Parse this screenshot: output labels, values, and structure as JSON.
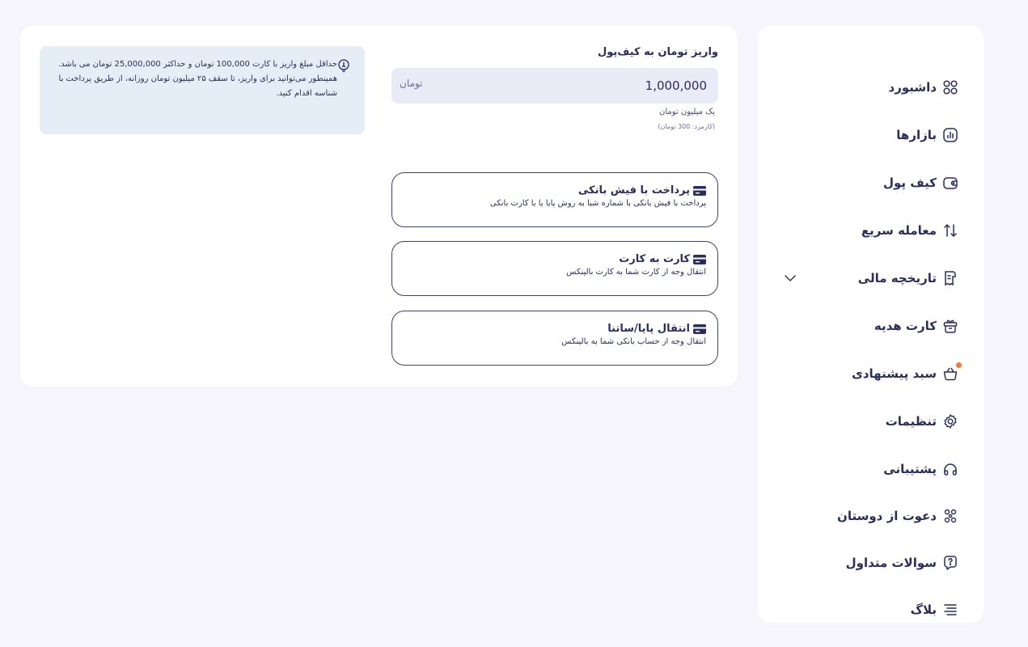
{
  "sidebar": {
    "items": [
      {
        "label": "داشبورد",
        "icon": "dashboard-grid-icon"
      },
      {
        "label": "بازارها",
        "icon": "markets-chart-icon"
      },
      {
        "label": "کیف پول",
        "icon": "wallet-icon"
      },
      {
        "label": "معامله سریع",
        "icon": "swap-arrows-icon"
      },
      {
        "label": "تاریخچه مالی",
        "icon": "receipt-icon",
        "expandable": true
      },
      {
        "label": "کارت هدیه",
        "icon": "gift-icon"
      },
      {
        "label": "سبد پیشنهادی",
        "icon": "basket-icon",
        "badge_dot": true
      },
      {
        "label": "تنظیمات",
        "icon": "gear-icon"
      },
      {
        "label": "پشتیبانی",
        "icon": "headphones-icon"
      },
      {
        "label": "دعوت از دوستان",
        "icon": "invite-friends-icon"
      },
      {
        "label": "سوالات متداول",
        "icon": "faq-chat-icon"
      },
      {
        "label": "بلاگ",
        "icon": "blog-lines-icon"
      }
    ]
  },
  "deposit": {
    "title": "واریز تومان به کیف‌پول",
    "amount_value": "1,000,000",
    "amount_unit": "تومان",
    "amount_words": "یک میلیون تومان",
    "fee_text": "(کارمزد: 300 تومان)"
  },
  "methods": [
    {
      "title": "پرداخت با فیش بانکی",
      "desc": "پرداخت با فیش بانکی با شماره شبا به روش پایا یا با کارت بانکی"
    },
    {
      "title": "کارت به کارت",
      "desc": "انتقال وجه از کارت شما به کارت بالینکس"
    },
    {
      "title": "انتقال پایا/ساتنا",
      "desc": "انتقال وجه از حساب بانکی شما به بالینکس"
    }
  ],
  "info": {
    "text": "حداقل مبلغ واریز با کارت 100,000 تومان و حداکثر 25,000,000 تومان می باشد. همینطور می‌توانید برای واریز، تا سقف ۲۵ میلیون تومان روزانه، از طریق پرداخت با شناسه اقدام کنید."
  },
  "colors": {
    "background": "#f5f5fb",
    "card": "#ffffff",
    "text_primary": "#2b2d5c",
    "input_bg": "#ebebf7",
    "info_bg": "#e5eef6",
    "badge_dot": "#f07a3a"
  }
}
